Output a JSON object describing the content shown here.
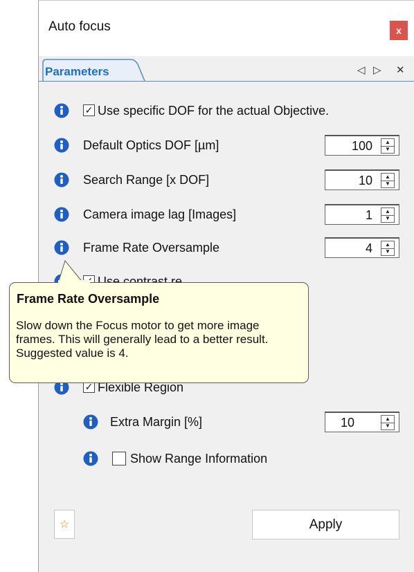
{
  "window": {
    "title": "Auto focus",
    "close_label": "x"
  },
  "tabs": {
    "active": "Parameters",
    "prev_glyph": "◁",
    "next_glyph": "▷",
    "close_glyph": "✕"
  },
  "options": {
    "use_dof": {
      "label": "Use specific DOF for the actual Objective.",
      "checked": true
    },
    "default_dof": {
      "label": "Default Optics DOF [µm]",
      "value": "100"
    },
    "search_range": {
      "label": "Search Range [x DOF]",
      "value": "10"
    },
    "image_lag": {
      "label": "Camera image lag [Images]",
      "value": "1"
    },
    "frame_rate": {
      "label": "Frame Rate Oversample",
      "value": "4"
    },
    "hidden_option": {
      "label": "Use contrast re...",
      "checked": true
    },
    "flexible_region": {
      "label": "Flexible Region",
      "checked": true
    },
    "extra_margin": {
      "label": "Extra Margin [%]",
      "value": "10"
    },
    "show_range": {
      "label": "Show Range Information",
      "checked": false
    }
  },
  "tooltip": {
    "title": "Frame Rate Oversample",
    "body": "Slow down the Focus motor to get more image frames. This will generally lead to a better result. Suggested value is 4."
  },
  "footer": {
    "apply_label": "Apply",
    "star_glyph": "☆"
  },
  "colors": {
    "info_icon": "#1f5fbf",
    "tab_text": "#1c6fc4",
    "close_button": "#d9534f",
    "tooltip_bg": "#ffffe1"
  }
}
